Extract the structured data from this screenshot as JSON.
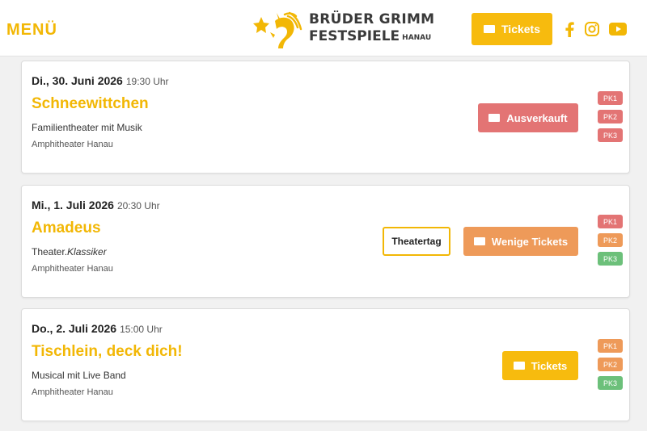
{
  "header": {
    "menu_label": "MENÜ",
    "logo_line1": "BRÜDER GRIMM",
    "logo_line2": "FESTSPIELE",
    "logo_line2_small": "HANAU",
    "tickets_label": "Tickets",
    "social": [
      "facebook-icon",
      "instagram-icon",
      "youtube-icon"
    ]
  },
  "colors": {
    "brand_yellow": "#f2b705",
    "sold_out_red": "#e37474",
    "few_tickets_orange": "#ee9a59",
    "available_green": "#6cc07a"
  },
  "events": [
    {
      "date": "Di., 30. Juni 2026",
      "time": "19:30 Uhr",
      "title": "Schneewittchen",
      "genre": "Familientheater mit Musik",
      "venue": "Amphitheater Hanau",
      "button_label": "Ausverkauft",
      "price_categories": [
        "PK1",
        "PK2",
        "PK3"
      ]
    },
    {
      "date": "Mi., 1. Juli 2026",
      "time": "20:30 Uhr",
      "title": "Amadeus",
      "genre_prefix": "Theater.",
      "genre_italic": "Klassiker",
      "venue": "Amphitheater Hanau",
      "tag_label": "Theatertag",
      "button_label": "Wenige Tickets",
      "price_categories": [
        "PK1",
        "PK2",
        "PK3"
      ]
    },
    {
      "date": "Do., 2. Juli 2026",
      "time": "15:00 Uhr",
      "title": "Tischlein, deck dich!",
      "genre": "Musical mit Live Band",
      "venue": "Amphitheater Hanau",
      "button_label": "Tickets",
      "price_categories": [
        "PK1",
        "PK2",
        "PK3"
      ]
    }
  ]
}
